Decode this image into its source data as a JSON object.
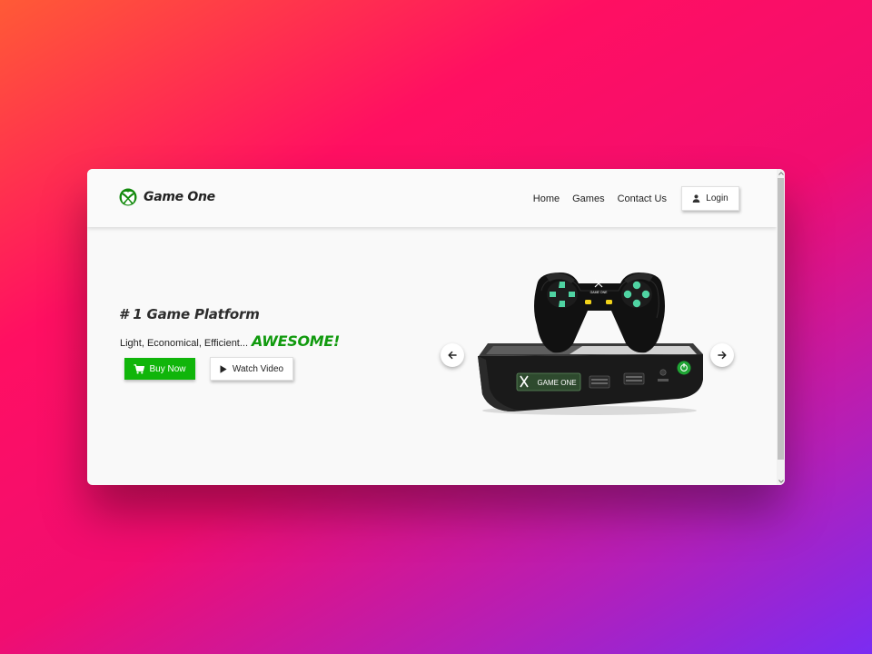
{
  "brand": {
    "name": "Game One",
    "logo_icon": "xbox-logo-icon",
    "accent_color": "#0f9d0b"
  },
  "nav": {
    "links": [
      "Home",
      "Games",
      "Contact Us"
    ],
    "login_label": "Login",
    "login_icon": "user-icon"
  },
  "hero": {
    "title": "# 1 Game Platform",
    "tagline": "Light, Economical, Efficient...",
    "tagline_accent": "AWESOME!",
    "buy_label": "Buy Now",
    "buy_icon": "cart-icon",
    "watch_label": "Watch Video",
    "watch_icon": "play-icon"
  },
  "product": {
    "console_label": "GAME ONE",
    "controller_label": "GAME ONE",
    "image": "game-console-with-controller"
  },
  "carousel": {
    "prev_icon": "arrow-left-icon",
    "next_icon": "arrow-right-icon"
  },
  "colors": {
    "primary_green": "#10b50a",
    "accent_green": "#119a0e",
    "page_bg": "#f9f9f9"
  }
}
